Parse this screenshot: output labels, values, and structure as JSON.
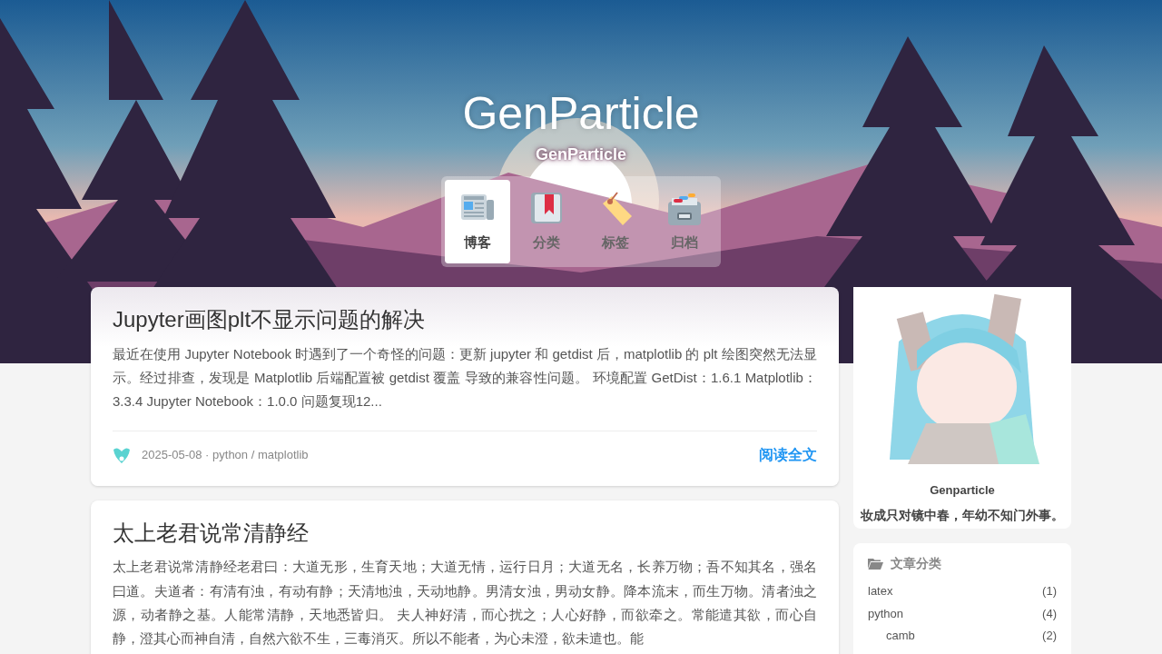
{
  "site": {
    "title": "GenParticle",
    "subtitle": "GenParticle"
  },
  "menu": [
    {
      "label": "博客",
      "kind": "newspaper",
      "selected": true
    },
    {
      "label": "分类",
      "kind": "book",
      "selected": false
    },
    {
      "label": "标签",
      "kind": "tag",
      "selected": false
    },
    {
      "label": "归档",
      "kind": "cabinet",
      "selected": false
    }
  ],
  "posts": [
    {
      "title": "Jupyter画图plt不显示问题的解决",
      "excerpt": "最近在使用 Jupyter Notebook 时遇到了一个奇怪的问题：更新 jupyter 和 getdist 后，matplotlib 的 plt 绘图突然无法显示。经过排查，发现是 Matplotlib 后端配置被 getdist 覆盖 导致的兼容性问题。 环境配置 GetDist：1.6.1 Matplotlib：3.3.4 Jupyter Notebook：1.0.0 问题复现12...",
      "meta": "2025-05-08 · python / matplotlib",
      "read_more": "阅读全文"
    },
    {
      "title": "太上老君说常清静经",
      "excerpt": "太上老君说常清静经老君曰：大道无形，生育天地；大道无情，运行日月；大道无名，长养万物；吾不知其名，强名曰道。夫道者：有清有浊，有动有静；天清地浊，天动地静。男清女浊，男动女静。降本流末，而生万物。清者浊之源，动者静之基。人能常清静，天地悉皆归。 夫人神好清，而心扰之；人心好静，而欲牵之。常能遣其欲，而心自静，澄其心而神自清，自然六欲不生，三毒消灭。所以不能者，为心未澄，欲未遣也。能"
    }
  ],
  "profile": {
    "name": "Genparticle",
    "motto": "妆成只对镜中春，年幼不知门外事。"
  },
  "categories": {
    "title": "文章分类",
    "items": [
      {
        "name": "latex",
        "count": "(1)"
      },
      {
        "name": "python",
        "count": "(4)",
        "children": [
          {
            "name": "camb",
            "count": "(2)"
          }
        ]
      }
    ]
  }
}
